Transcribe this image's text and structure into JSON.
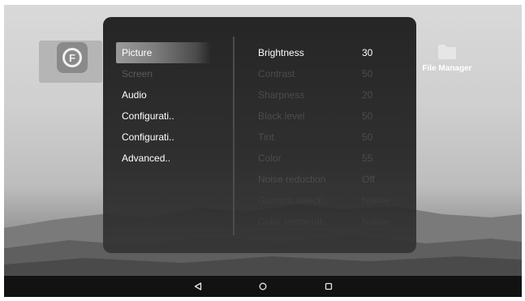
{
  "desktop": {
    "file_manager_label": "File Manager"
  },
  "menu": {
    "items": [
      {
        "label": "Picture",
        "state": "selected"
      },
      {
        "label": "Screen",
        "state": "disabled"
      },
      {
        "label": "Audio",
        "state": "normal"
      },
      {
        "label": "Configurati..",
        "state": "normal"
      },
      {
        "label": "Configurati..",
        "state": "normal"
      },
      {
        "label": "Advanced..",
        "state": "normal"
      }
    ]
  },
  "settings": [
    {
      "name": "Brightness",
      "value": "30"
    },
    {
      "name": "Contrast",
      "value": "50"
    },
    {
      "name": "Sharpness",
      "value": "20"
    },
    {
      "name": "Black level",
      "value": "50"
    },
    {
      "name": "Tint",
      "value": "50"
    },
    {
      "name": "Color",
      "value": "55"
    },
    {
      "name": "Noise reduction",
      "value": "Off"
    },
    {
      "name": "Gamma selecti..",
      "value": "Native"
    },
    {
      "name": "Color temperat..",
      "value": "Native"
    }
  ],
  "navbar": {
    "icons": [
      "back-triangle-icon",
      "home-circle-icon",
      "recents-square-icon"
    ]
  },
  "colors": {
    "panel_bg": "#1c1c1c",
    "text_active": "#ffffff",
    "text_disabled": "#4c4c4c",
    "highlight": "#8a8a8a",
    "navbar_bg": "#121212"
  }
}
